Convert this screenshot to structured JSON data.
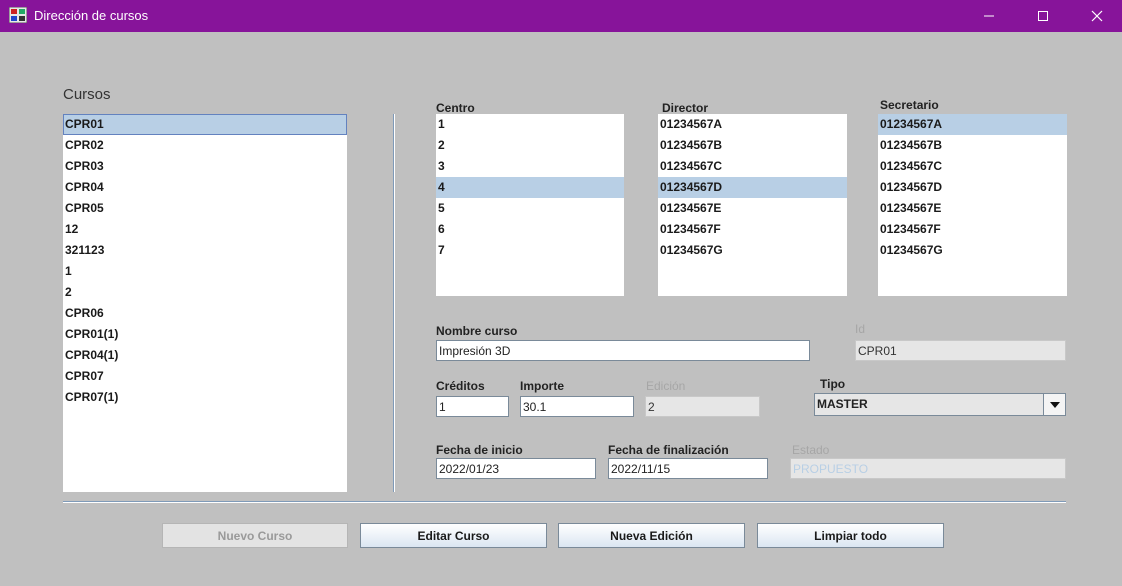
{
  "window": {
    "title": "Dirección de cursos",
    "controls": {
      "minimize": "—",
      "maximize": "☐",
      "close": "✕"
    }
  },
  "cursos": {
    "label": "Cursos",
    "items": [
      "CPR01",
      "CPR02",
      "CPR03",
      "CPR04",
      "CPR05",
      "12",
      "321123",
      "1",
      "2",
      "CPR06",
      "CPR01(1)",
      "CPR04(1)",
      "CPR07",
      "CPR07(1)"
    ],
    "selected": "CPR01"
  },
  "centro": {
    "label": "Centro",
    "items": [
      "1",
      "2",
      "3",
      "4",
      "5",
      "6",
      "7"
    ],
    "selected": "4"
  },
  "director": {
    "label": "Director",
    "items": [
      "01234567A",
      "01234567B",
      "01234567C",
      "01234567D",
      "01234567E",
      "01234567F",
      "01234567G"
    ],
    "selected": "01234567D"
  },
  "secretario": {
    "label": "Secretario",
    "items": [
      "01234567A",
      "01234567B",
      "01234567C",
      "01234567D",
      "01234567E",
      "01234567F",
      "01234567G"
    ],
    "selected": "01234567A"
  },
  "form": {
    "nombre_label": "Nombre curso",
    "nombre_value": "Impresión 3D",
    "id_label": "Id",
    "id_value": "CPR01",
    "creditos_label": "Créditos",
    "creditos_value": "1",
    "importe_label": "Importe",
    "importe_value": "30.1",
    "edicion_label": "Edición",
    "edicion_value": "2",
    "tipo_label": "Tipo",
    "tipo_value": "MASTER",
    "fecha_inicio_label": "Fecha de inicio",
    "fecha_inicio_value": "2022/01/23",
    "fecha_fin_label": "Fecha de finalización",
    "fecha_fin_value": "2022/11/15",
    "estado_label": "Estado",
    "estado_value": "PROPUESTO"
  },
  "buttons": {
    "nuevo": "Nuevo Curso",
    "editar": "Editar Curso",
    "nueva_edicion": "Nueva Edición",
    "limpiar": "Limpiar todo"
  }
}
